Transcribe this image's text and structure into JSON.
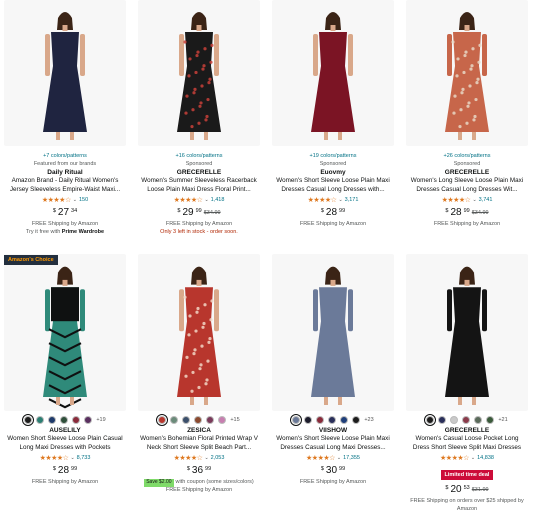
{
  "badge": {
    "prefix": "Amazon's",
    "suffix": "Choice"
  },
  "products": [
    {
      "colors": "+7 colors/patterns",
      "meta": "Featured from our brands",
      "brand": "Daily Ritual",
      "title": "Amazon Brand - Daily Ritual Women's Jersey Sleeveless Empire-Waist Maxi...",
      "stars": "★★★★☆",
      "reviews": "150",
      "price_whole": "27",
      "price_cents": "34",
      "price_old": "",
      "lines": [
        "FREE Shipping by Amazon"
      ],
      "extra_pre": "Try it free with ",
      "extra_bold": "Prime Wardrobe",
      "dress_color": "#1f2440",
      "accent_color": "#3a3f5c"
    },
    {
      "colors": "+16 colors/patterns",
      "meta": "Sponsored",
      "brand": "GRECERELLE",
      "title": "Women's Summer Sleeveless Racerback Loose Plain Maxi Dress Floral Print...",
      "stars": "★★★★☆",
      "reviews": "1,418",
      "price_whole": "29",
      "price_cents": "99",
      "price_old": "$34.99",
      "lines": [
        "FREE Shipping by Amazon"
      ],
      "red_line": "Only 3 left in stock - order soon.",
      "dress_color": "#1a1a1a",
      "accent_color": "#c9413a"
    },
    {
      "colors": "+19 colors/patterns",
      "meta": "Sponsored",
      "brand": "Euovmy",
      "title": "Women's Short Sleeve Loose Plain Maxi Dresses Casual Long Dresses with...",
      "stars": "★★★★☆",
      "reviews": "3,171",
      "price_whole": "28",
      "price_cents": "99",
      "price_old": "",
      "lines": [
        "FREE Shipping by Amazon"
      ],
      "dress_color": "#7b1424",
      "accent_color": "#5c0e1a"
    },
    {
      "colors": "+26 colors/patterns",
      "meta": "Sponsored",
      "brand": "GRECERELLE",
      "title": "Women's Long Sleeve Loose Plain Maxi Dresses Casual Long Dresses Wit...",
      "stars": "★★★★☆",
      "reviews": "3,741",
      "price_whole": "28",
      "price_cents": "99",
      "price_old": "$34.99",
      "lines": [
        "FREE Shipping by Amazon"
      ],
      "dress_color": "#c7664a",
      "accent_color": "#e8d7c4"
    },
    {
      "swatches": [
        "#1c1c1c",
        "#2c7f73",
        "#1e3a6b",
        "#2f4f3a",
        "#8a2a3a",
        "#5a2f5f"
      ],
      "more": "+19",
      "brand": "AUSELILY",
      "title": "Women Short Sleeve Loose Plain Casual Long Maxi Dresses with Pockets",
      "stars": "★★★★☆",
      "reviews": "8,733",
      "price_whole": "28",
      "price_cents": "99",
      "price_old": "",
      "lines": [
        "FREE Shipping by Amazon"
      ],
      "dress_color": "#2f8a7a",
      "accent_color": "#0f1111"
    },
    {
      "swatches": [
        "#b8362d",
        "#6b8b7a",
        "#3b4f6b",
        "#8b4a2f",
        "#7a3a5a",
        "#c77fb0"
      ],
      "more": "+15",
      "brand": "ZESICA",
      "title": "Women's Bohemian Floral Printed Wrap V Neck Short Sleeve Split Beach Part...",
      "stars": "★★★★☆",
      "reviews": "2,053",
      "price_whole": "36",
      "price_cents": "99",
      "price_old": "",
      "coupon": "Save $2.00",
      "coupon_text": "with coupon (some sizes/colors)",
      "lines": [
        "FREE Shipping by Amazon"
      ],
      "dress_color": "#b8362d",
      "accent_color": "#f1d6c6"
    },
    {
      "swatches": [
        "#6b7a99",
        "#1c1c2c",
        "#8a2a3a",
        "#2a2f5a",
        "#1f3f7a",
        "#1c1c1c"
      ],
      "more": "+23",
      "brand": "VIISHOW",
      "title": "Women's Short Sleeve Loose Plain Maxi Dresses Casual Long Maxi Dresses...",
      "stars": "★★★★☆",
      "reviews": "17,355",
      "price_whole": "30",
      "price_cents": "99",
      "price_old": "",
      "lines": [
        "FREE Shipping by Amazon"
      ],
      "dress_color": "#6b7a99",
      "accent_color": "#4e5b78"
    },
    {
      "swatches": [
        "#1c1c1c",
        "#2a2f5a",
        "#c9c9c9",
        "#8a3a4a",
        "#5a6a5a",
        "#3a5a3a"
      ],
      "more": "+21",
      "brand": "GRECERELLE",
      "title": "Women's Casual Loose Pocket Long Dress Short Sleeve Split Maxi Dresses",
      "stars": "★★★★☆",
      "reviews": "14,838",
      "deal": "Limited time deal",
      "price_whole": "20",
      "price_cents": "53",
      "price_old": "$31.99",
      "lines": [
        "FREE Shipping on orders over $25 shipped by Amazon"
      ],
      "dress_color": "#141414",
      "accent_color": "#2a2a2a"
    }
  ]
}
